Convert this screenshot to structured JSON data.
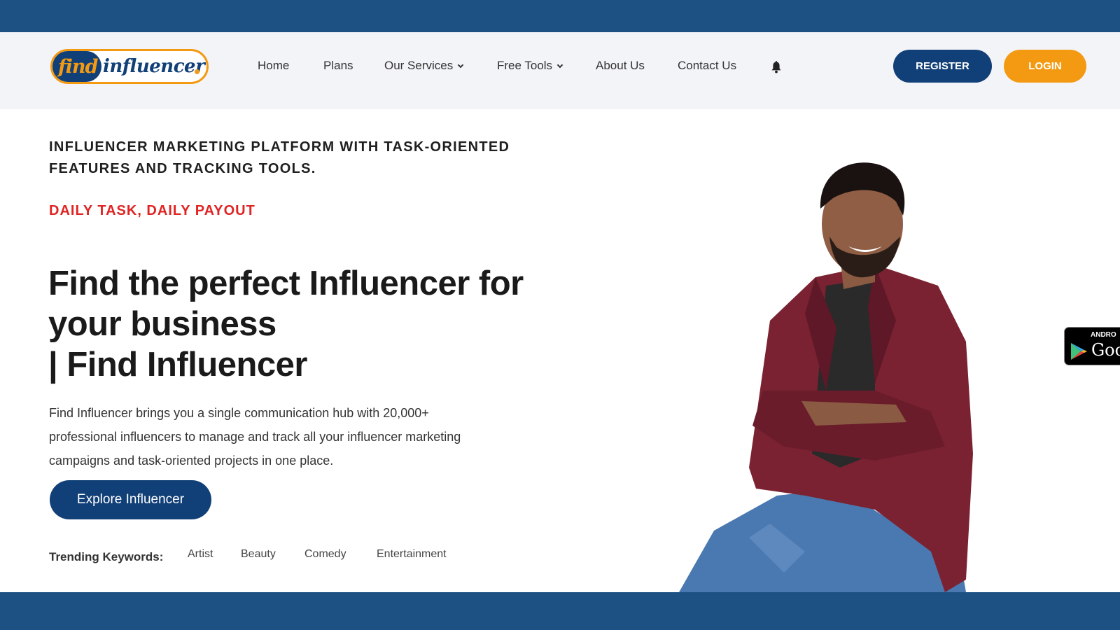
{
  "brand": {
    "logo_find": "find",
    "logo_rest": "influencer",
    "colors": {
      "navy": "#113f77",
      "band": "#1d5183",
      "orange": "#f39a12",
      "red": "#e02424",
      "header_bg": "#f3f4f8"
    }
  },
  "nav": {
    "items": [
      {
        "label": "Home",
        "dropdown": false
      },
      {
        "label": "Plans",
        "dropdown": false
      },
      {
        "label": "Our Services",
        "dropdown": true
      },
      {
        "label": "Free Tools",
        "dropdown": true
      },
      {
        "label": "About Us",
        "dropdown": false
      },
      {
        "label": "Contact Us",
        "dropdown": false
      }
    ],
    "bell_icon": "bell-icon",
    "register_label": "REGISTER",
    "login_label": "LOGIN"
  },
  "hero": {
    "tagline": "INFLUENCER MARKETING PLATFORM WITH TASK-ORIENTED FEATURES AND TRACKING TOOLS.",
    "daily": "DAILY TASK, DAILY PAYOUT",
    "title_lines": [
      "Find the perfect Influencer for",
      "your business",
      "| Find Influencer"
    ],
    "description_lines": [
      "Find Influencer brings you a single communication hub with 20,000+",
      "professional influencers to manage and track all your influencer marketing",
      "campaigns and task-oriented projects in one place."
    ],
    "cta_label": "Explore Influencer",
    "trending_label": "Trending Keywords:",
    "keywords": [
      "Artist",
      "Beauty",
      "Comedy",
      "Entertainment"
    ]
  },
  "play_badge": {
    "small": "ANDRO",
    "big": "Goo",
    "icon": "google-play-icon"
  }
}
